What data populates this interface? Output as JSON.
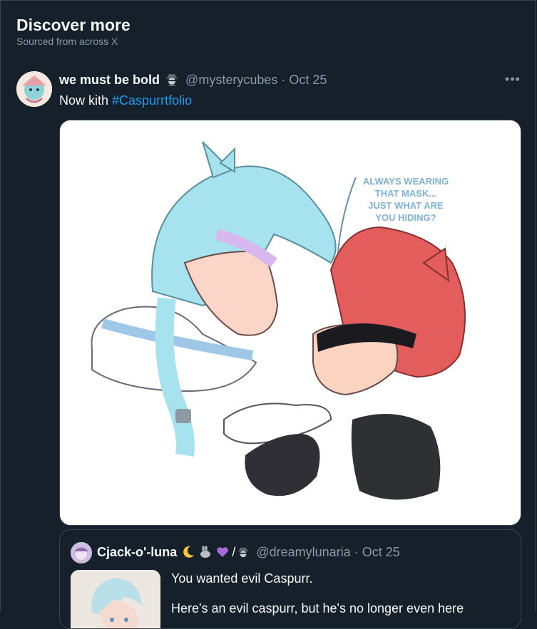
{
  "section": {
    "title": "Discover more",
    "subtitle": "Sourced from across X"
  },
  "post": {
    "display_name": "we must be bold",
    "badge_icon": "spy-emoji-icon",
    "handle": "@mysterycubes",
    "separator": "·",
    "date": "Oct 25",
    "more_label": "•••",
    "text_prefix": "Now kith ",
    "hashtag": "#Caspurrtfolio",
    "image_speech": [
      "ALWAYS WEARING",
      "THAT MASK...",
      "JUST WHAT ARE",
      "YOU HIDING?"
    ]
  },
  "quoted_post": {
    "display_name": "Cjack-o'-luna",
    "emoji_icons": [
      "crescent-moon-icon",
      "rabbit-icon",
      "purple-heart-icon",
      "spy-emoji-icon"
    ],
    "emoji_divider": "/",
    "handle": "@dreamylunaria",
    "separator": "·",
    "date": "Oct 25",
    "text": "You wanted evil Caspurr.",
    "text_second_line": "Here's an evil caspurr, but he's no longer even here"
  },
  "colors": {
    "background": "#15202b",
    "text": "#f7f9f9",
    "muted": "#8b98a5",
    "link": "#1d9bf0",
    "border": "#38444d"
  }
}
